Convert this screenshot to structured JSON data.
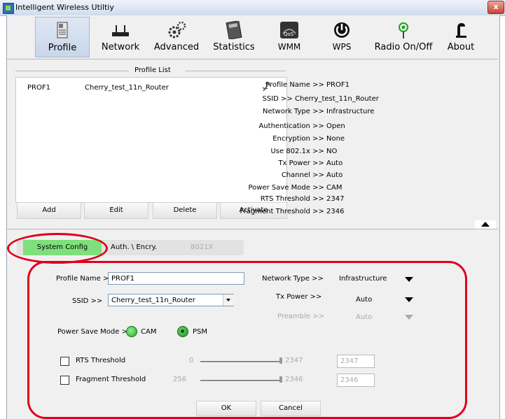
{
  "window": {
    "title": "Intelligent Wireless Utiltiy",
    "close_label": "x"
  },
  "toolbar": {
    "items": [
      {
        "label": "Profile"
      },
      {
        "label": "Network"
      },
      {
        "label": "Advanced"
      },
      {
        "label": "Statistics"
      },
      {
        "label": "WMM"
      },
      {
        "label": "WPS"
      },
      {
        "label": "Radio On/Off"
      },
      {
        "label": "About"
      }
    ],
    "wmm_badge": "QoS"
  },
  "profile_list": {
    "heading": "Profile List",
    "rows": [
      {
        "name": "PROF1",
        "ssid": "Cherry_test_11n_Router"
      }
    ],
    "buttons": {
      "add": "Add",
      "edit": "Edit",
      "delete": "Delete",
      "activate": "Activate"
    }
  },
  "profile_info": [
    {
      "label": "Profile Name >> ",
      "value": "PROF1"
    },
    {
      "label": "SSID >> ",
      "value": "Cherry_test_11n_Router"
    },
    {
      "label": "Network Type >> ",
      "value": "Infrastructure"
    },
    {
      "label": "Authentication >> ",
      "value": "Open"
    },
    {
      "label": "Encryption >> ",
      "value": "None"
    },
    {
      "label": "Use 802.1x >> ",
      "value": "NO"
    },
    {
      "label": "Tx Power >> ",
      "value": "Auto"
    },
    {
      "label": "Channel >> ",
      "value": "Auto"
    },
    {
      "label": "Power Save Mode >> ",
      "value": "CAM"
    },
    {
      "label": "RTS Threshold >> ",
      "value": "2347"
    },
    {
      "label": "Fragment Threshold >> ",
      "value": "2346"
    }
  ],
  "tabs": {
    "system_config": "System Config",
    "auth_encry": "Auth. \\ Encry.",
    "8021x": "8021X"
  },
  "form": {
    "profile_name_label": "Profile Name >>",
    "profile_name_value": "PROF1",
    "ssid_label": "SSID >>",
    "ssid_value": "Cherry_test_11n_Router",
    "network_type_label": "Network Type >>",
    "network_type_value": "Infrastructure",
    "tx_power_label": "Tx Power >>",
    "tx_power_value": "Auto",
    "preamble_label": "Preamble >>",
    "preamble_value": "Auto",
    "power_save_label": "Power Save Mode >>",
    "cam_label": "CAM",
    "psm_label": "PSM",
    "rts_label": "RTS Threshold",
    "rts_min": "0",
    "rts_max": "2347",
    "rts_value": "2347",
    "frag_label": "Fragment Threshold",
    "frag_min": "256",
    "frag_max": "2346",
    "frag_value": "2346",
    "ok": "OK",
    "cancel": "Cancel"
  },
  "colors": {
    "tab_active": "#7ee07a",
    "highlight": "#e0001b",
    "radio_on": "#39c739"
  }
}
